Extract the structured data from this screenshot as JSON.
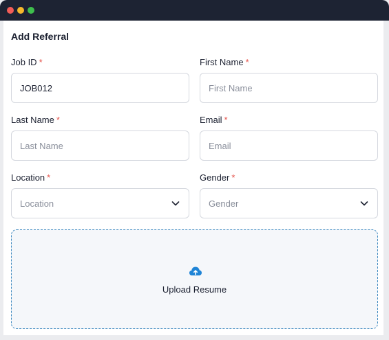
{
  "window": {
    "controls": {
      "close": "close",
      "minimize": "minimize",
      "maximize": "maximize"
    }
  },
  "form": {
    "title": "Add Referral",
    "required_marker": "*",
    "job_id": {
      "label": "Job ID",
      "value": "JOB012",
      "placeholder": "Job ID"
    },
    "first_name": {
      "label": "First Name",
      "value": "",
      "placeholder": "First Name"
    },
    "last_name": {
      "label": "Last Name",
      "value": "",
      "placeholder": "Last Name"
    },
    "email": {
      "label": "Email",
      "value": "",
      "placeholder": "Email"
    },
    "location": {
      "label": "Location",
      "selected": "Location",
      "icon": "chevron-down-icon"
    },
    "gender": {
      "label": "Gender",
      "selected": "Gender",
      "icon": "chevron-down-icon"
    },
    "upload": {
      "label": "Upload Resume",
      "icon": "cloud-upload-icon"
    }
  },
  "colors": {
    "titlebar": "#1d2333",
    "required": "#e5534b",
    "upload_border": "#3a87bf",
    "upload_icon": "#1f84d6"
  }
}
